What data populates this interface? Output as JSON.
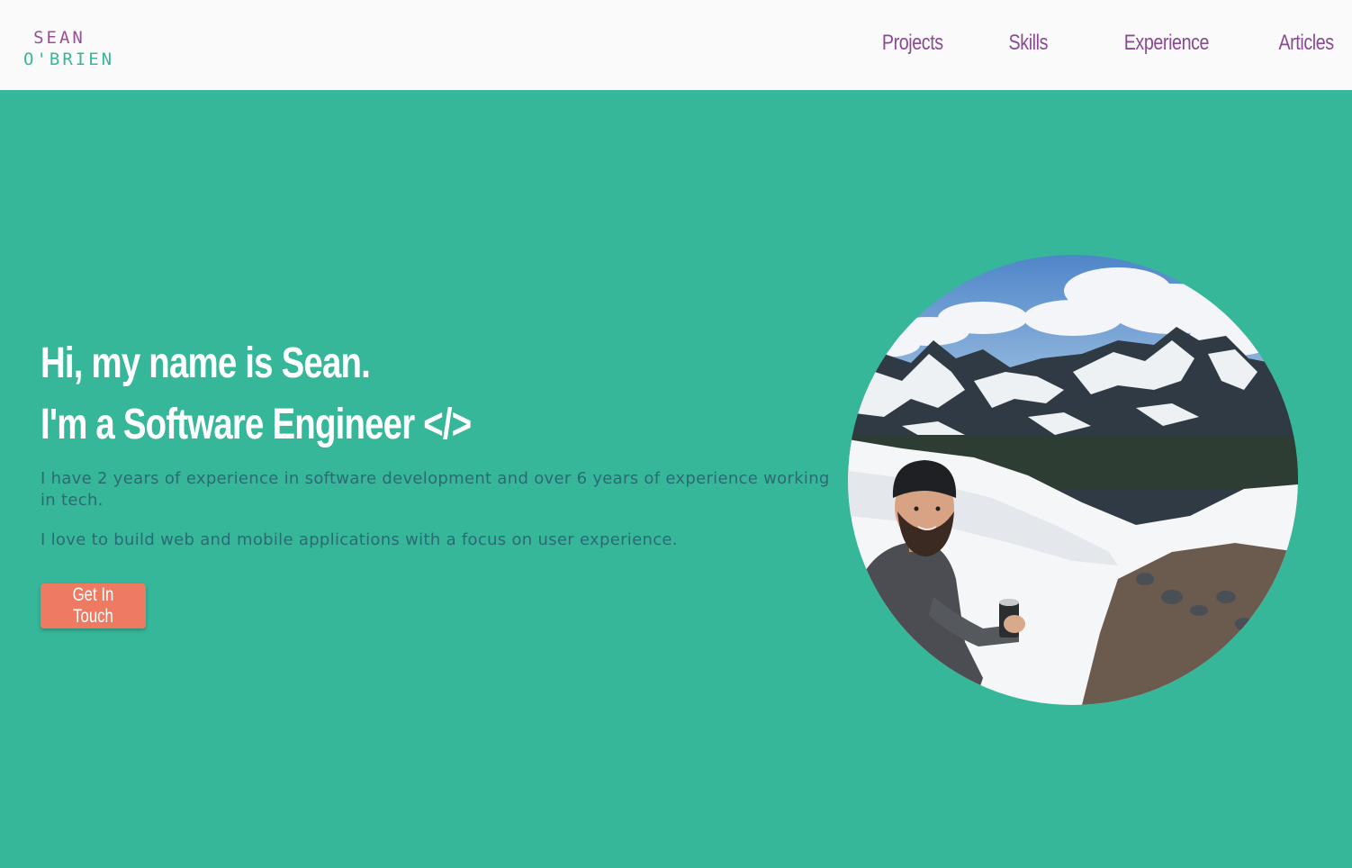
{
  "header": {
    "logo": {
      "first": "SEAN",
      "last": "O'BRIEN"
    },
    "nav": [
      {
        "label": "Projects"
      },
      {
        "label": "Skills"
      },
      {
        "label": "Experience"
      },
      {
        "label": "Articles"
      }
    ]
  },
  "hero": {
    "headline_line1": "Hi, my name is Sean.",
    "headline_line2": "I'm a Software Engineer </>",
    "bio_1": "I have 2 years of experience in software development and over 6 years of experience working in tech.",
    "bio_2": "I love to build web and mobile applications with a focus on user experience.",
    "cta_label": "Get In Touch"
  },
  "colors": {
    "background": "#37b79a",
    "navbar": "#fafafa",
    "nav_link": "#8a4a93",
    "logo_first": "#9a4d99",
    "logo_last": "#37b79a",
    "cta": "#ee7a62",
    "bio_text": "#2b6a74"
  }
}
